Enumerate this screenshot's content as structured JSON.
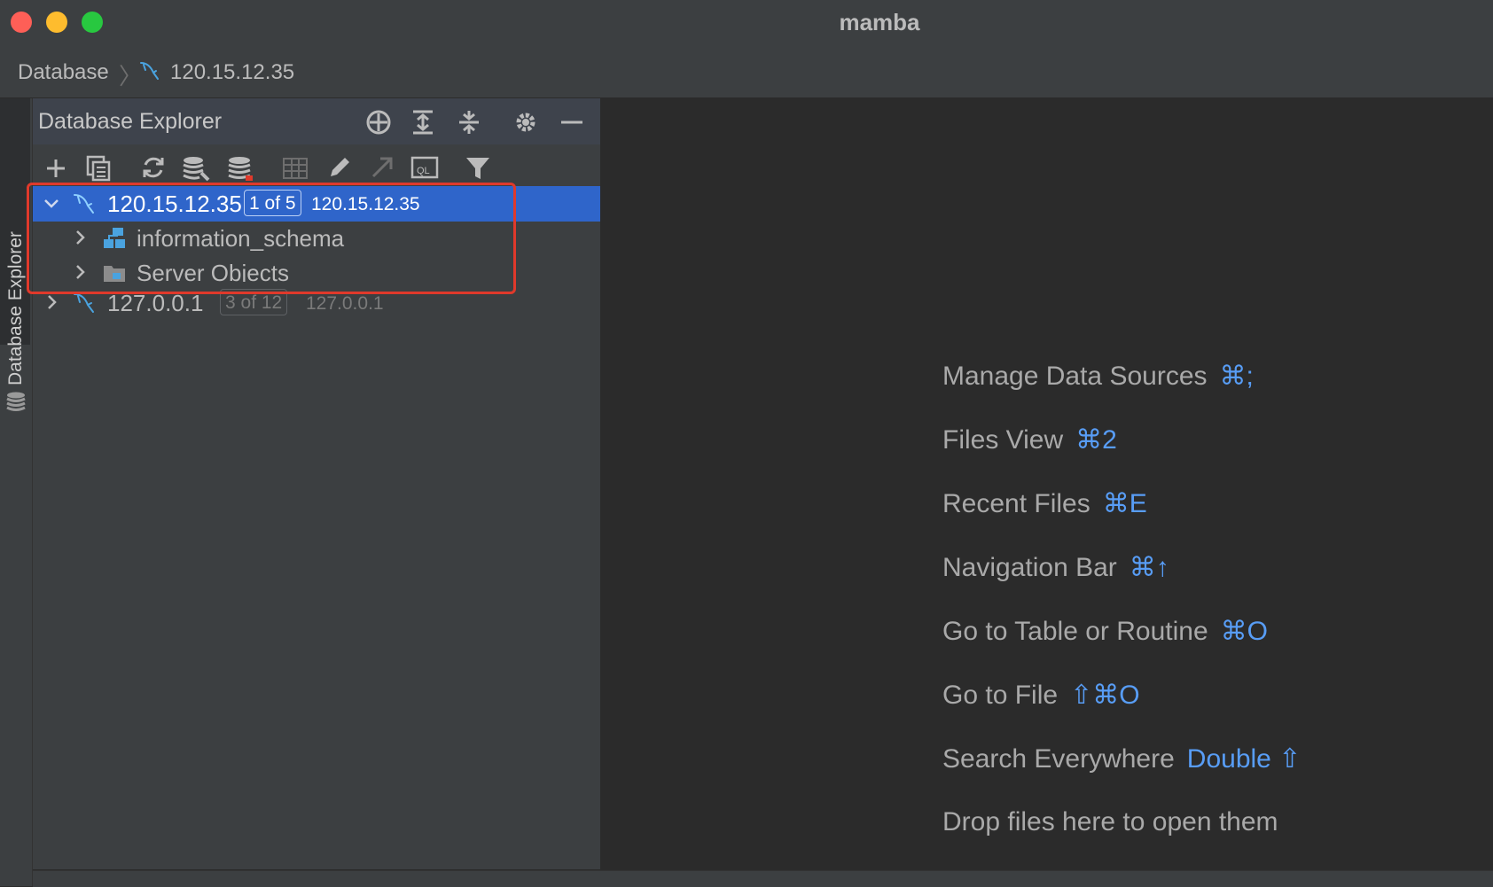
{
  "window": {
    "title": "mamba"
  },
  "navbar": {
    "breadcrumb": [
      "Database",
      "120.15.12.35"
    ]
  },
  "side_tab": {
    "label": "Database Explorer"
  },
  "panel": {
    "title": "Database Explorer",
    "header_icons": [
      "crosshair-icon",
      "expand-all-icon",
      "collapse-all-icon",
      "gear-icon",
      "minimize-icon"
    ],
    "toolbar_icons": [
      "add-icon",
      "duplicate-icon",
      "refresh-icon",
      "data-source-properties-icon",
      "database-icon",
      "table-icon",
      "edit-icon",
      "jump-icon",
      "sql-console-icon",
      "filter-icon"
    ]
  },
  "tree": {
    "nodes": [
      {
        "label": "120.15.12.35",
        "badge": "1 of 5",
        "detail": "120.15.12.35",
        "expanded": true,
        "selected": true,
        "children": [
          {
            "label": "information_schema"
          },
          {
            "label": "Server Objects"
          }
        ]
      },
      {
        "label": "127.0.0.1",
        "badge": "3 of 12",
        "detail": "127.0.0.1",
        "expanded": false,
        "selected": false
      }
    ]
  },
  "hints": [
    {
      "label": "Manage Data Sources",
      "shortcut": "⌘;"
    },
    {
      "label": "Files View",
      "shortcut": "⌘2"
    },
    {
      "label": "Recent Files",
      "shortcut": "⌘E"
    },
    {
      "label": "Navigation Bar",
      "shortcut": "⌘↑"
    },
    {
      "label": "Go to Table or Routine",
      "shortcut": "⌘O"
    },
    {
      "label": "Go to File",
      "shortcut": "⇧⌘O"
    },
    {
      "label": "Search Everywhere",
      "shortcut": "Double ⇧"
    },
    {
      "label": "Drop files here to open them",
      "shortcut": ""
    }
  ],
  "colors": {
    "accent": "#589df6",
    "selection": "#2f65ca",
    "highlight_box": "#e0392b"
  }
}
